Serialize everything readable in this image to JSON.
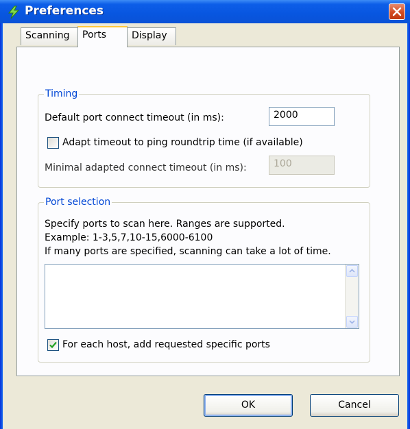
{
  "window": {
    "title": "Preferences",
    "icon": "lightning-app-icon",
    "close_icon": "close-icon"
  },
  "tabs": [
    {
      "label": "Scanning",
      "active": false
    },
    {
      "label": "Ports",
      "active": true
    },
    {
      "label": "Display",
      "active": false
    }
  ],
  "timing": {
    "legend": "Timing",
    "default_timeout_label": "Default port connect timeout (in ms):",
    "default_timeout_value": "2000",
    "adapt_label": "Adapt timeout to ping roundtrip time (if available)",
    "adapt_checked": false,
    "minimal_timeout_label": "Minimal adapted connect timeout (in ms):",
    "minimal_timeout_value": "100"
  },
  "port_selection": {
    "legend": "Port selection",
    "description_line1": "Specify ports to scan here. Ranges are supported.",
    "description_line2": "Example: 1-3,5,7,10-15,6000-6100",
    "description_line3": "If many ports are specified, scanning can take a lot of time.",
    "ports_value": "",
    "add_requested_label": "For each host, add requested specific ports",
    "add_requested_checked": true
  },
  "buttons": {
    "ok": "OK",
    "cancel": "Cancel"
  },
  "colors": {
    "titlebar": "#0a52d6",
    "legend": "#0046d5",
    "dialog_bg": "#ece9d8",
    "check_mark": "#21a121"
  }
}
